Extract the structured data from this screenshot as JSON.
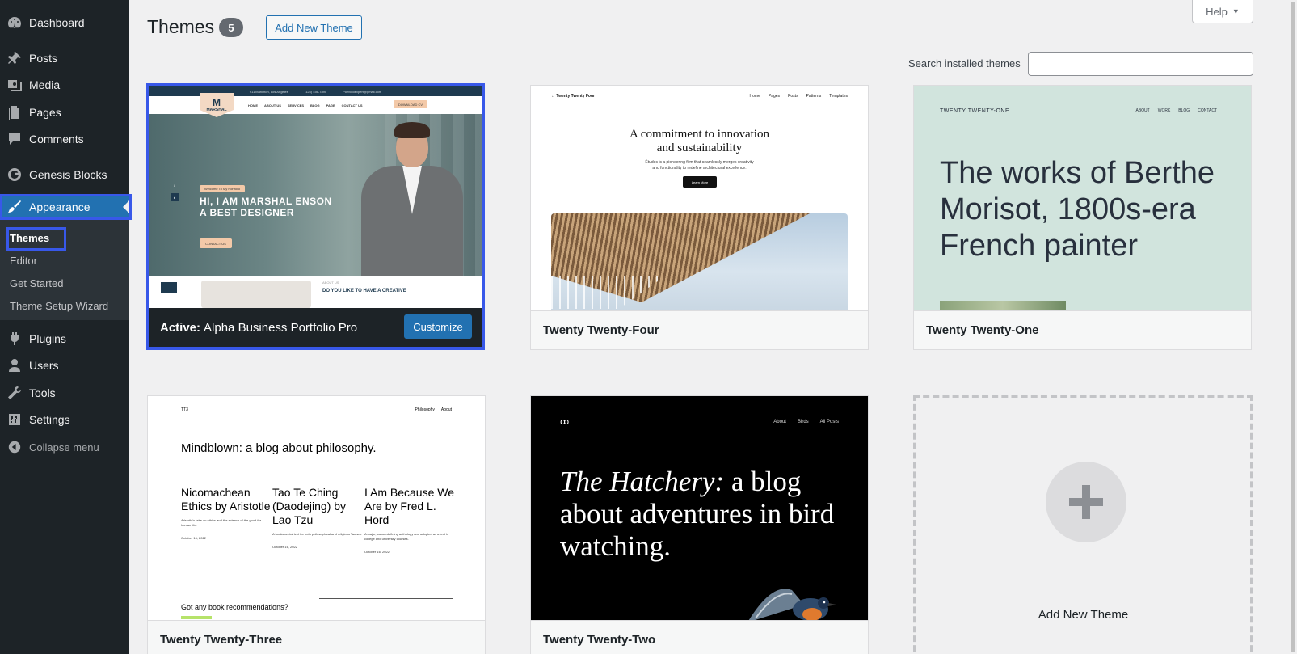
{
  "sidebar": {
    "items": [
      {
        "label": "Dashboard",
        "icon": "dashboard-icon"
      },
      {
        "label": "Posts",
        "icon": "pin-icon"
      },
      {
        "label": "Media",
        "icon": "media-icon"
      },
      {
        "label": "Pages",
        "icon": "pages-icon"
      },
      {
        "label": "Comments",
        "icon": "comment-icon"
      },
      {
        "label": "Genesis Blocks",
        "icon": "genesis-icon"
      },
      {
        "label": "Appearance",
        "icon": "brush-icon"
      },
      {
        "label": "Plugins",
        "icon": "plugin-icon"
      },
      {
        "label": "Users",
        "icon": "user-icon"
      },
      {
        "label": "Tools",
        "icon": "wrench-icon"
      },
      {
        "label": "Settings",
        "icon": "settings-icon"
      }
    ],
    "submenu": [
      "Themes",
      "Editor",
      "Get Started",
      "Theme Setup Wizard"
    ],
    "collapse_label": "Collapse menu"
  },
  "header": {
    "title": "Themes",
    "count": "5",
    "add_new_label": "Add New Theme",
    "help_label": "Help",
    "search_label": "Search installed themes",
    "search_value": ""
  },
  "themes": {
    "active": {
      "prefix": "Active:",
      "name": "Alpha Business Portfolio Pro",
      "customize_label": "Customize",
      "preview": {
        "top_bar": [
          "911 Marlinton, Los Angeles",
          "(123) 456-7890",
          "Portfolioexpert@gmail.com"
        ],
        "logo": "MARSHAL",
        "menu": [
          "HOME",
          "ABOUT US",
          "SERVICES",
          "BLOG",
          "PAGE",
          "CONTACT US"
        ],
        "download": "DOWNLOAD CV",
        "welcome": "Welcome To My Portfolio",
        "headline_1": "HI, I AM MARSHAL ENSON",
        "headline_2": "A BEST DESIGNER",
        "contact": "CONTACT US",
        "about": "ABOUT US",
        "like": "DO YOU LIKE TO HAVE A CREATIVE"
      }
    },
    "t24": {
      "name": "Twenty Twenty-Four",
      "preview": {
        "site": "Twenty Twenty Four",
        "links": [
          "Home",
          "Pages",
          "Posts",
          "Patterns",
          "Templates"
        ],
        "headline_1": "A commitment to innovation",
        "headline_2": "and sustainability",
        "text_1": "Études is a pioneering firm that seamlessly merges creativity",
        "text_2": "and functionality to redefine architectural excellence.",
        "button": "Learn More"
      }
    },
    "t21": {
      "name": "Twenty Twenty-One",
      "preview": {
        "site": "TWENTY TWENTY-ONE",
        "links": [
          "ABOUT",
          "WORK",
          "BLOG",
          "CONTACT"
        ],
        "headline": "The works of Berthe Morisot, 1800s-era French painter"
      }
    },
    "t23": {
      "name": "Twenty Twenty-Three",
      "preview": {
        "site": "TT3",
        "links": [
          "Philosophy",
          "About"
        ],
        "headline": "Mindblown: a blog about philosophy.",
        "posts": [
          {
            "title": "Nicomachean Ethics by Aristotle",
            "desc": "Aristotle's take on ethics and the science of the good for human life.",
            "date": "October 16, 2022"
          },
          {
            "title": "Tao Te Ching (Daodejing) by Lao Tzu",
            "desc": "A fundamental text for both philosophical and religious Taoism.",
            "date": "October 16, 2022"
          },
          {
            "title": "I Am Because We Are by Fred L. Hord",
            "desc": "A major, canon-defining anthology and adopted as a text in college and university courses.",
            "date": "October 16, 2022"
          }
        ],
        "question": "Got any book recommendations?"
      }
    },
    "t22": {
      "name": "Twenty Twenty-Two",
      "preview": {
        "links": [
          "About",
          "Birds",
          "All Posts"
        ],
        "headline_em": "The Hatchery:",
        "headline_rest": " a blog about adventures in bird watching."
      }
    },
    "add_new_label": "Add New Theme"
  },
  "colors": {
    "sidebar_bg": "#1d2327",
    "accent": "#2271b1",
    "highlight_outline": "#3858e9"
  }
}
